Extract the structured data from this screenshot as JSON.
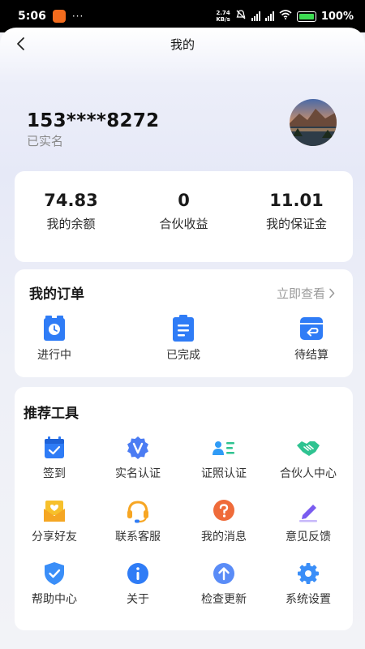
{
  "status_bar": {
    "time": "5:06",
    "dots": "···",
    "net_speed_value": "2.74",
    "net_speed_unit": "KB/s",
    "battery_percent": "100%"
  },
  "nav": {
    "title": "我的"
  },
  "user": {
    "phone": "153****8272",
    "verify_status": "已实名"
  },
  "balance": {
    "items": [
      {
        "value": "74.83",
        "label": "我的余额"
      },
      {
        "value": "0",
        "label": "合伙收益"
      },
      {
        "value": "11.01",
        "label": "我的保证金"
      }
    ]
  },
  "orders": {
    "title": "我的订单",
    "view_all": "立即查看",
    "items": [
      {
        "label": "进行中",
        "icon": "clock-clipboard-icon"
      },
      {
        "label": "已完成",
        "icon": "document-lines-icon"
      },
      {
        "label": "待结算",
        "icon": "return-box-icon"
      }
    ]
  },
  "tools": {
    "title": "推荐工具",
    "items": [
      {
        "label": "签到",
        "icon": "calendar-check-icon"
      },
      {
        "label": "实名认证",
        "icon": "verified-badge-icon"
      },
      {
        "label": "证照认证",
        "icon": "id-card-icon"
      },
      {
        "label": "合伙人中心",
        "icon": "handshake-icon"
      },
      {
        "label": "分享好友",
        "icon": "share-envelope-icon"
      },
      {
        "label": "联系客服",
        "icon": "headset-icon"
      },
      {
        "label": "我的消息",
        "icon": "question-bubble-icon"
      },
      {
        "label": "意见反馈",
        "icon": "edit-pen-icon"
      },
      {
        "label": "帮助中心",
        "icon": "shield-check-icon"
      },
      {
        "label": "关于",
        "icon": "info-icon"
      },
      {
        "label": "检查更新",
        "icon": "arrow-up-circle-icon"
      },
      {
        "label": "系统设置",
        "icon": "gear-icon"
      }
    ]
  },
  "colors": {
    "primary_blue": "#2f7cf6",
    "teal_green": "#2fc391",
    "yellow": "#f7c02b",
    "orange_red": "#ef6b3a",
    "purple": "#7a5cf0"
  }
}
